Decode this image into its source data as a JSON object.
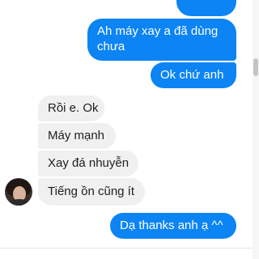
{
  "messages": {
    "outgoing_1": "Ah máy xay a đã dùng chưa",
    "outgoing_2": "Ok chứ anh",
    "incoming_1": "Rồi e. Ok",
    "incoming_2": "Máy mạnh",
    "incoming_3": "Xay đá nhuyễn",
    "incoming_4": "Tiếng ồn cũng ít",
    "outgoing_3": "Dạ thanks anh ạ ^^"
  },
  "colors": {
    "outgoing_bubble": "#0c84f3",
    "incoming_bubble": "#f1f0f0"
  },
  "icons": {
    "avatar": "contact-avatar-photo"
  }
}
